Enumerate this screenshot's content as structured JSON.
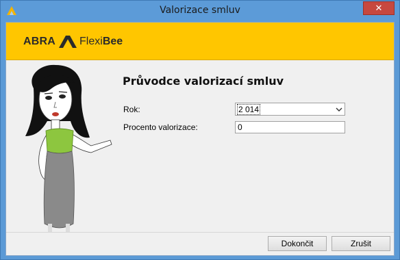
{
  "window": {
    "title": "Valorizace smluv",
    "close_glyph": "✕",
    "app_icon": "abra-flexibee-icon"
  },
  "banner": {
    "logo_abra": "ABRA",
    "logo_flexi": "Flexi",
    "logo_bee": "Bee",
    "color": "#ffc600"
  },
  "wizard": {
    "heading": "Průvodce valorizací smluv",
    "year_label": "Rok:",
    "year_value": "2 014",
    "percent_label": "Procento valorizace:",
    "percent_value": "0"
  },
  "buttons": {
    "finish": "Dokončit",
    "cancel": "Zrušit"
  },
  "colors": {
    "titlebar": "#5c9bd8",
    "close": "#c7483f",
    "top_accent": "#8dc63f"
  }
}
